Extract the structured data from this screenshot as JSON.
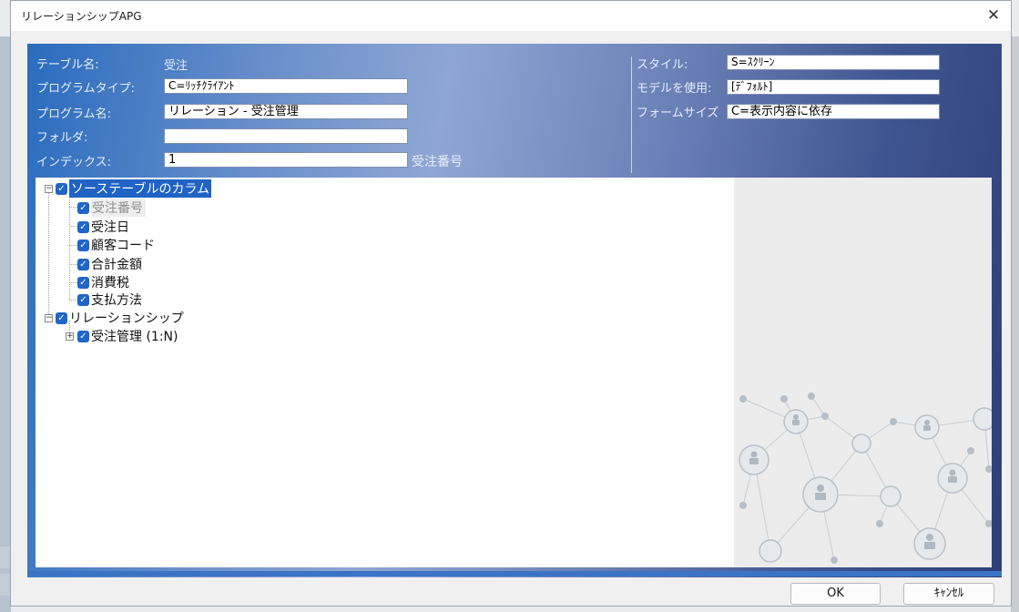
{
  "window": {
    "title": "リレーションシップAPG",
    "close_symbol": "✕"
  },
  "header": {
    "table_name_label": "テーブル名:",
    "table_name_value": "受注",
    "program_type_label": "プログラムタイプ:",
    "program_type_value": "C=ﾘｯﾁｸﾗｲｱﾝﾄ",
    "program_name_label": "プログラム名:",
    "program_name_value": "リレーション - 受注管理",
    "folder_label": "フォルダ:",
    "folder_value": "",
    "index_label": "インデックス:",
    "index_value": "1",
    "index_desc": "受注番号",
    "style_label": "スタイル:",
    "style_value": "S=ｽｸﾘｰﾝ",
    "model_label": "モデルを使用:",
    "model_value": "[ﾃﾞﾌｫﾙﾄ]",
    "form_size_label": "フォームサイズ",
    "form_size_value": "C=表示内容に依存"
  },
  "tree": {
    "source_columns": {
      "label": "ソーステーブルのカラム",
      "children": [
        "受注番号",
        "受注日",
        "顧客コード",
        "合計金額",
        "消費税",
        "支払方法"
      ]
    },
    "relationships": {
      "label": "リレーションシップ",
      "children": [
        "受注管理 (1:N)"
      ]
    }
  },
  "buttons": {
    "ok": "OK",
    "cancel": "ｷｬﾝｾﾙ"
  },
  "colors": {
    "check": "#1f66c7",
    "selection": "#1f63c4"
  },
  "icons": {
    "check": "check-icon",
    "collapse": "minus-box-icon",
    "expand": "plus-box-icon"
  }
}
